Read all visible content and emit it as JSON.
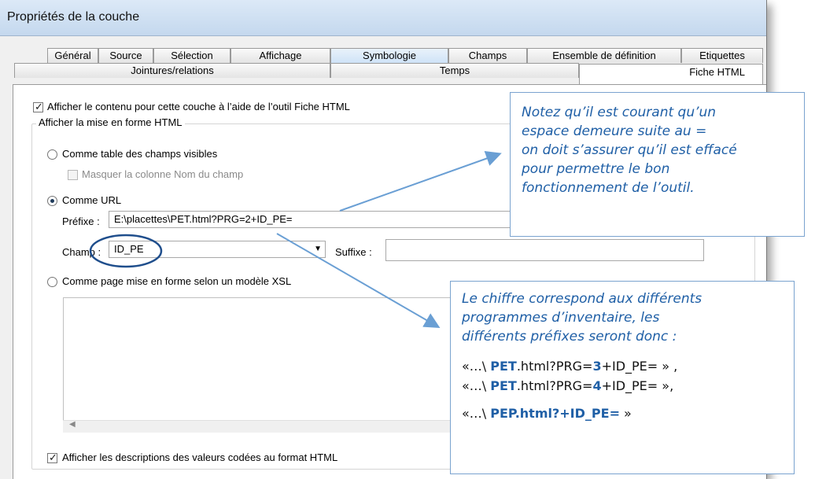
{
  "window": {
    "title": "Propriétés de la couche"
  },
  "tabs_row1": [
    {
      "label": "Général"
    },
    {
      "label": "Source"
    },
    {
      "label": "Sélection"
    },
    {
      "label": "Affichage"
    },
    {
      "label": "Symbologie"
    },
    {
      "label": "Champs"
    },
    {
      "label": "Ensemble de définition"
    },
    {
      "label": "Etiquettes"
    }
  ],
  "tabs_row2": [
    {
      "label": "Jointures/relations"
    },
    {
      "label": "Temps"
    },
    {
      "label": "Fiche HTML"
    }
  ],
  "form": {
    "show_content_label": "Afficher le contenu pour cette couche à l’aide de l’outil Fiche HTML",
    "group_title": "Afficher la mise en forme HTML",
    "option_table_label": "Comme table des champs visibles",
    "hide_field_name_label": "Masquer la colonne Nom du champ",
    "option_url_label": "Comme URL",
    "prefix_label": "Préfixe :",
    "prefix_value": "E:\\placettes\\PET.html?PRG=2+ID_PE=",
    "field_label": "Champ :",
    "field_value": "ID_PE",
    "suffix_label": "Suffixe :",
    "suffix_value": "",
    "option_xsl_label": "Comme page mise en forme selon un modèle XSL",
    "coded_values_label": "Afficher les descriptions des valeurs codées au format HTML"
  },
  "callout_top": {
    "lines": [
      "Notez qu’il est courant qu’un",
      "espace demeure suite au =",
      "on doit s’assurer qu’il est effacé",
      "pour permettre le bon",
      "fonctionnement de l’outil."
    ]
  },
  "callout_bottom": {
    "lines": [
      "Le chiffre correspond aux différents",
      "programmes d’inventaire, les",
      "différents préfixes seront donc :"
    ],
    "examples": [
      {
        "pre": "«…\\ ",
        "bold": "PET",
        "mid": ".html?PRG=",
        "num": "3",
        "post": "+ID_PE= » ,"
      },
      {
        "pre": "«…\\ ",
        "bold": "PET",
        "mid": ".html?PRG=",
        "num": "4",
        "post": "+ID_PE= »,"
      },
      {
        "pre": "«…\\ ",
        "bold": "PEP.html?+ID_PE",
        "mid": "",
        "num": "=",
        "post": " »"
      }
    ]
  },
  "colors": {
    "accent": "#1f5fa6",
    "callout_border": "#7aa3cf",
    "arrow": "#6a9fd4",
    "circle": "#1f4e8c"
  }
}
